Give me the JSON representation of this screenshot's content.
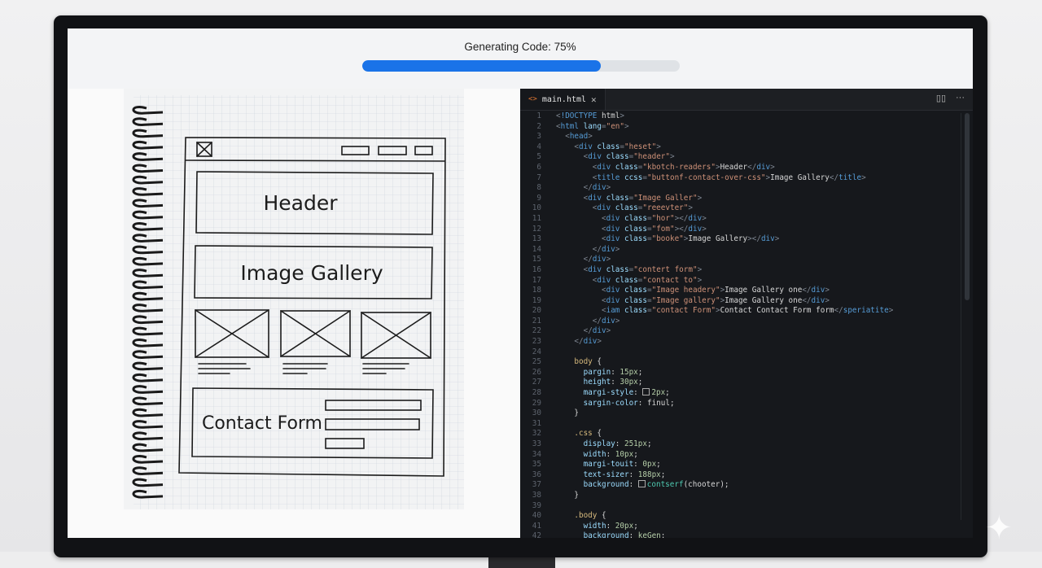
{
  "progress": {
    "label": "Generating Code: 75%",
    "value": 0.75,
    "color": "#1a73e8"
  },
  "sketch": {
    "header_label": "Header",
    "gallery_label": "Image Gallery",
    "contact_label": "Contact Form"
  },
  "editor": {
    "tab_label": "main.html",
    "tab_icon": "html-brackets-icon",
    "close_icon": "close-icon",
    "split_icon": "split-editor-icon",
    "more_icon": "more-icon",
    "lines": [
      [
        [
          "p",
          "<"
        ],
        [
          "t",
          "!DOCTYPE"
        ],
        [
          "x",
          " html"
        ],
        [
          "p",
          ">"
        ]
      ],
      [
        [
          "p",
          "<"
        ],
        [
          "t",
          "html"
        ],
        [
          "a",
          " lang"
        ],
        [
          "p",
          "="
        ],
        [
          "s",
          "\"en\""
        ],
        [
          "p",
          ">"
        ]
      ],
      [
        [
          "x",
          "  "
        ],
        [
          "p",
          "<"
        ],
        [
          "t",
          "head"
        ],
        [
          "p",
          ">"
        ]
      ],
      [
        [
          "x",
          "    "
        ],
        [
          "p",
          "<"
        ],
        [
          "t",
          "div"
        ],
        [
          "a",
          " class"
        ],
        [
          "p",
          "="
        ],
        [
          "s",
          "\"heset\""
        ],
        [
          "p",
          ">"
        ]
      ],
      [
        [
          "x",
          "      "
        ],
        [
          "p",
          "<"
        ],
        [
          "t",
          "div"
        ],
        [
          "a",
          " class"
        ],
        [
          "p",
          "="
        ],
        [
          "s",
          "\"header\""
        ],
        [
          "p",
          ">"
        ]
      ],
      [
        [
          "x",
          "        "
        ],
        [
          "p",
          "<"
        ],
        [
          "t",
          "div"
        ],
        [
          "a",
          " class"
        ],
        [
          "p",
          "="
        ],
        [
          "s",
          "\"kbotch-readers\""
        ],
        [
          "p",
          ">"
        ],
        [
          "x",
          "Header"
        ],
        [
          "p",
          "</"
        ],
        [
          "t",
          "div"
        ],
        [
          "p",
          ">"
        ]
      ],
      [
        [
          "x",
          "        "
        ],
        [
          "p",
          "<"
        ],
        [
          "t",
          "title"
        ],
        [
          "a",
          " ccss"
        ],
        [
          "p",
          "="
        ],
        [
          "s",
          "\"buttonf-contact-over-css\""
        ],
        [
          "p",
          ">"
        ],
        [
          "x",
          "Image Gallery"
        ],
        [
          "p",
          "</"
        ],
        [
          "t",
          "title"
        ],
        [
          "p",
          ">"
        ]
      ],
      [
        [
          "x",
          "      "
        ],
        [
          "p",
          "</"
        ],
        [
          "t",
          "div"
        ],
        [
          "p",
          ">"
        ]
      ],
      [
        [
          "x",
          "      "
        ],
        [
          "p",
          "<"
        ],
        [
          "t",
          "div"
        ],
        [
          "a",
          " class"
        ],
        [
          "p",
          "="
        ],
        [
          "s",
          "\"Image Galler\""
        ],
        [
          "p",
          ">"
        ]
      ],
      [
        [
          "x",
          "        "
        ],
        [
          "p",
          "<"
        ],
        [
          "t",
          "div"
        ],
        [
          "a",
          " class"
        ],
        [
          "p",
          "="
        ],
        [
          "s",
          "\"reeevter\""
        ],
        [
          "p",
          ">"
        ]
      ],
      [
        [
          "x",
          "          "
        ],
        [
          "p",
          "<"
        ],
        [
          "t",
          "div"
        ],
        [
          "a",
          " class"
        ],
        [
          "p",
          "="
        ],
        [
          "s",
          "\"hor\""
        ],
        [
          "p",
          "></"
        ],
        [
          "t",
          "div"
        ],
        [
          "p",
          ">"
        ]
      ],
      [
        [
          "x",
          "          "
        ],
        [
          "p",
          "<"
        ],
        [
          "t",
          "div"
        ],
        [
          "a",
          " class"
        ],
        [
          "p",
          "="
        ],
        [
          "s",
          "\"fom\""
        ],
        [
          "p",
          "></"
        ],
        [
          "t",
          "div"
        ],
        [
          "p",
          ">"
        ]
      ],
      [
        [
          "x",
          "          "
        ],
        [
          "p",
          "<"
        ],
        [
          "t",
          "div"
        ],
        [
          "a",
          " class"
        ],
        [
          "p",
          "="
        ],
        [
          "s",
          "\"booke\""
        ],
        [
          "p",
          ">"
        ],
        [
          "x",
          "Image Gallery"
        ],
        [
          "p",
          "></"
        ],
        [
          "t",
          "div"
        ],
        [
          "p",
          ">"
        ]
      ],
      [
        [
          "x",
          "        "
        ],
        [
          "p",
          "</"
        ],
        [
          "t",
          "div"
        ],
        [
          "p",
          ">"
        ]
      ],
      [
        [
          "x",
          "      "
        ],
        [
          "p",
          "</"
        ],
        [
          "t",
          "div"
        ],
        [
          "p",
          ">"
        ]
      ],
      [
        [
          "x",
          "      "
        ],
        [
          "p",
          "<"
        ],
        [
          "t",
          "div"
        ],
        [
          "a",
          " class"
        ],
        [
          "p",
          "="
        ],
        [
          "s",
          "\"contert form\""
        ],
        [
          "p",
          ">"
        ]
      ],
      [
        [
          "x",
          "        "
        ],
        [
          "p",
          "<"
        ],
        [
          "t",
          "div"
        ],
        [
          "a",
          " class"
        ],
        [
          "p",
          "="
        ],
        [
          "s",
          "\"contact to\""
        ],
        [
          "p",
          ">"
        ]
      ],
      [
        [
          "x",
          "          "
        ],
        [
          "p",
          "<"
        ],
        [
          "t",
          "div"
        ],
        [
          "a",
          " class"
        ],
        [
          "p",
          "="
        ],
        [
          "s",
          "\"Image headery\""
        ],
        [
          "p",
          ">"
        ],
        [
          "x",
          "Image Gallery one"
        ],
        [
          "p",
          "</"
        ],
        [
          "t",
          "div"
        ],
        [
          "p",
          ">"
        ]
      ],
      [
        [
          "x",
          "          "
        ],
        [
          "p",
          "<"
        ],
        [
          "t",
          "div"
        ],
        [
          "a",
          " class"
        ],
        [
          "p",
          "="
        ],
        [
          "s",
          "\"Image gallery\""
        ],
        [
          "p",
          ">"
        ],
        [
          "x",
          "Image Gallery one"
        ],
        [
          "p",
          "</"
        ],
        [
          "t",
          "div"
        ],
        [
          "p",
          ">"
        ]
      ],
      [
        [
          "x",
          "          "
        ],
        [
          "p",
          "<"
        ],
        [
          "t",
          "iam"
        ],
        [
          "a",
          " class"
        ],
        [
          "p",
          "="
        ],
        [
          "s",
          "\"contact Form\""
        ],
        [
          "p",
          ">"
        ],
        [
          "x",
          "Contact Contact Form form"
        ],
        [
          "p",
          "</"
        ],
        [
          "t",
          "speriatite"
        ],
        [
          "p",
          ">"
        ]
      ],
      [
        [
          "x",
          "        "
        ],
        [
          "p",
          "</"
        ],
        [
          "t",
          "div"
        ],
        [
          "p",
          ">"
        ]
      ],
      [
        [
          "x",
          "      "
        ],
        [
          "p",
          "</"
        ],
        [
          "t",
          "div"
        ],
        [
          "p",
          ">"
        ]
      ],
      [
        [
          "x",
          "    "
        ],
        [
          "p",
          "</"
        ],
        [
          "t",
          "div"
        ],
        [
          "p",
          ">"
        ]
      ],
      [
        [
          "x",
          ""
        ]
      ],
      [
        [
          "x",
          "    "
        ],
        [
          "e",
          "body"
        ],
        [
          "x",
          " {"
        ]
      ],
      [
        [
          "x",
          "      "
        ],
        [
          "r",
          "pargin"
        ],
        [
          "x",
          ": "
        ],
        [
          "v",
          "15px"
        ],
        [
          "x",
          ";"
        ]
      ],
      [
        [
          "x",
          "      "
        ],
        [
          "r",
          "height"
        ],
        [
          "x",
          ": "
        ],
        [
          "v",
          "30px"
        ],
        [
          "x",
          ";"
        ]
      ],
      [
        [
          "x",
          "      "
        ],
        [
          "r",
          "margi-style"
        ],
        [
          "x",
          ": "
        ],
        [
          "w",
          ""
        ],
        [
          "v",
          "2px"
        ],
        [
          "x",
          ";"
        ]
      ],
      [
        [
          "x",
          "      "
        ],
        [
          "r",
          "sargin-color"
        ],
        [
          "x",
          ": "
        ],
        [
          "x",
          "finul"
        ],
        [
          "x",
          ";"
        ]
      ],
      [
        [
          "x",
          "    }"
        ]
      ],
      [
        [
          "x",
          ""
        ]
      ],
      [
        [
          "x",
          "    "
        ],
        [
          "e",
          ".css"
        ],
        [
          "x",
          " {"
        ]
      ],
      [
        [
          "x",
          "      "
        ],
        [
          "r",
          "display"
        ],
        [
          "x",
          ": "
        ],
        [
          "v",
          "251px"
        ],
        [
          "x",
          ";"
        ]
      ],
      [
        [
          "x",
          "      "
        ],
        [
          "r",
          "width"
        ],
        [
          "x",
          ": "
        ],
        [
          "v",
          "10px"
        ],
        [
          "x",
          ";"
        ]
      ],
      [
        [
          "x",
          "      "
        ],
        [
          "r",
          "margi-touit"
        ],
        [
          "x",
          ": "
        ],
        [
          "v",
          "0px"
        ],
        [
          "x",
          ";"
        ]
      ],
      [
        [
          "x",
          "      "
        ],
        [
          "r",
          "text-sizer"
        ],
        [
          "x",
          ": "
        ],
        [
          "v",
          "188px"
        ],
        [
          "x",
          ";"
        ]
      ],
      [
        [
          "x",
          "      "
        ],
        [
          "r",
          "background"
        ],
        [
          "x",
          ": "
        ],
        [
          "w",
          ""
        ],
        [
          "c",
          "contserf"
        ],
        [
          "x",
          "(chooter);"
        ]
      ],
      [
        [
          "x",
          "    }"
        ]
      ],
      [
        [
          "x",
          ""
        ]
      ],
      [
        [
          "x",
          "    "
        ],
        [
          "e",
          ".body"
        ],
        [
          "x",
          " {"
        ]
      ],
      [
        [
          "x",
          "      "
        ],
        [
          "r",
          "width"
        ],
        [
          "x",
          ": "
        ],
        [
          "v",
          "20px"
        ],
        [
          "x",
          ";"
        ]
      ],
      [
        [
          "x",
          "      "
        ],
        [
          "r",
          "background"
        ],
        [
          "x",
          ": "
        ],
        [
          "v",
          "keGen"
        ],
        [
          "x",
          ";"
        ]
      ]
    ]
  }
}
